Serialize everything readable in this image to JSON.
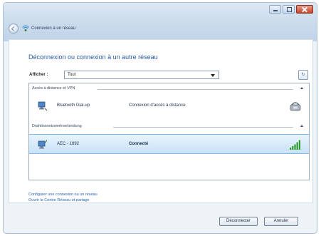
{
  "window": {
    "title": "Connexion à un réseau"
  },
  "main": {
    "heading": "Déconnexion ou connexion à un autre réseau",
    "show_label": "Afficher :",
    "show_value": "Tout"
  },
  "groups": [
    {
      "label": "Accès à distance et VPN",
      "items": [
        {
          "name": "Bluetooth Dial-up",
          "status": "Connexion d'accès à distance"
        }
      ]
    },
    {
      "label": "Drahtlosnetzwerkverbindung",
      "items": [
        {
          "name": "AEC - 1892",
          "status": "Connecté"
        }
      ]
    }
  ],
  "links": {
    "configure": "Configurer une connexion ou un réseau",
    "network_center": "Ouvrir le Centre Réseau et partage"
  },
  "buttons": {
    "disconnect": "Déconnecter",
    "cancel": "Annuler"
  },
  "colors": {
    "accent": "#2a5caa",
    "signal": "#2e9b2e"
  },
  "icons": {
    "back": "back-arrow-icon",
    "title": "network-icon",
    "refresh": "refresh-icon",
    "dialup": "computer-network-icon",
    "modem": "phone-modem-icon",
    "wifi": "wireless-network-icon",
    "signal": "signal-strength-icon"
  }
}
